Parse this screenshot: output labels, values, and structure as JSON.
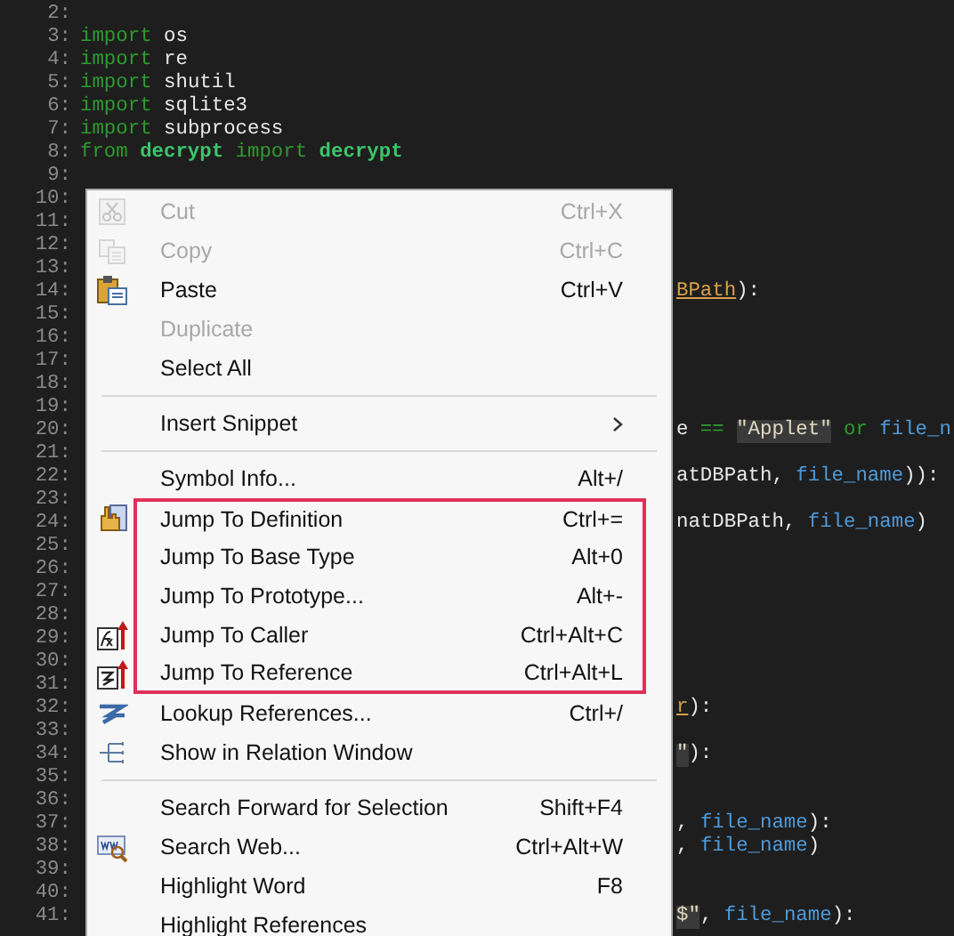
{
  "editor": {
    "lines": [
      {
        "number": "2:"
      },
      {
        "number": "3:",
        "clipped": false,
        "code": [
          {
            "text": "import",
            "kind": "keyword"
          },
          {
            "text": " os",
            "kind": "name"
          }
        ]
      },
      {
        "number": "4:",
        "clipped": false,
        "code": [
          {
            "text": "import",
            "kind": "keyword"
          },
          {
            "text": " re",
            "kind": "name"
          }
        ]
      },
      {
        "number": "5:",
        "clipped": false,
        "code": [
          {
            "text": "import",
            "kind": "keyword"
          },
          {
            "text": " shutil",
            "kind": "name"
          }
        ]
      },
      {
        "number": "6:",
        "clipped": false,
        "code": [
          {
            "text": "import",
            "kind": "keyword"
          },
          {
            "text": " sqlite3",
            "kind": "name"
          }
        ]
      },
      {
        "number": "7:",
        "clipped": false,
        "code": [
          {
            "text": "import",
            "kind": "keyword"
          },
          {
            "text": " subprocess",
            "kind": "name"
          }
        ]
      },
      {
        "number": "8:",
        "clipped": false,
        "code": [
          {
            "text": "from ",
            "kind": "keyword"
          },
          {
            "text": "decrypt",
            "kind": "module"
          },
          {
            "text": " import ",
            "kind": "keyword"
          },
          {
            "text": "decrypt",
            "kind": "module"
          }
        ]
      },
      {
        "number": "9:"
      },
      {
        "number": "10:"
      },
      {
        "number": "11:"
      },
      {
        "number": "12:"
      },
      {
        "number": "13:"
      },
      {
        "number": "14:",
        "clipped": true,
        "code": [
          {
            "text": "BPath",
            "kind": "reference"
          },
          {
            "text": "):",
            "kind": "name"
          }
        ]
      },
      {
        "number": "15:"
      },
      {
        "number": "16:"
      },
      {
        "number": "17:"
      },
      {
        "number": "18:"
      },
      {
        "number": "19:"
      },
      {
        "number": "20:",
        "clipped": true,
        "code": [
          {
            "text": "e",
            "kind": "name"
          },
          {
            "text": " == ",
            "kind": "operator"
          },
          {
            "text": "\"Applet\"",
            "kind": "string"
          },
          {
            "text": " or ",
            "kind": "keyword"
          },
          {
            "text": "file_n",
            "kind": "variable"
          }
        ]
      },
      {
        "number": "21:"
      },
      {
        "number": "22:",
        "clipped": true,
        "code": [
          {
            "text": "atDBPath, ",
            "kind": "name"
          },
          {
            "text": "file_name",
            "kind": "variable"
          },
          {
            "text": ")):",
            "kind": "name"
          }
        ]
      },
      {
        "number": "23:"
      },
      {
        "number": "24:",
        "clipped": true,
        "code": [
          {
            "text": "natDBPath, ",
            "kind": "name"
          },
          {
            "text": "file_name",
            "kind": "variable"
          },
          {
            "text": ")",
            "kind": "name"
          }
        ]
      },
      {
        "number": "25:"
      },
      {
        "number": "26:"
      },
      {
        "number": "27:"
      },
      {
        "number": "28:"
      },
      {
        "number": "29:"
      },
      {
        "number": "30:"
      },
      {
        "number": "31:"
      },
      {
        "number": "32:",
        "clipped": true,
        "code": [
          {
            "text": "r",
            "kind": "reference"
          },
          {
            "text": "):",
            "kind": "name"
          }
        ]
      },
      {
        "number": "33:"
      },
      {
        "number": "34:",
        "clipped": true,
        "code": [
          {
            "text": "\"",
            "kind": "string"
          },
          {
            "text": "):",
            "kind": "name"
          }
        ]
      },
      {
        "number": "35:"
      },
      {
        "number": "36:"
      },
      {
        "number": "37:",
        "clipped": true,
        "code": [
          {
            "text": ", ",
            "kind": "name"
          },
          {
            "text": "file_name",
            "kind": "variable"
          },
          {
            "text": "):",
            "kind": "name"
          }
        ]
      },
      {
        "number": "38:",
        "clipped": true,
        "code": [
          {
            "text": ", ",
            "kind": "name"
          },
          {
            "text": "file_name",
            "kind": "variable"
          },
          {
            "text": ")",
            "kind": "name"
          }
        ]
      },
      {
        "number": "39:"
      },
      {
        "number": "40:"
      },
      {
        "number": "41:",
        "clipped": true,
        "code": [
          {
            "text": "$\"",
            "kind": "string"
          },
          {
            "text": ", ",
            "kind": "name"
          },
          {
            "text": "file_name",
            "kind": "variable"
          },
          {
            "text": "):",
            "kind": "name"
          }
        ]
      }
    ]
  },
  "context_menu": {
    "groups": [
      {
        "items": [
          {
            "label": "Cut",
            "shortcut": "Ctrl+X",
            "disabled": true,
            "highlighted": false,
            "submenu": false
          },
          {
            "label": "Copy",
            "shortcut": "Ctrl+C",
            "disabled": true,
            "highlighted": false,
            "submenu": false
          },
          {
            "label": "Paste",
            "shortcut": "Ctrl+V",
            "disabled": false,
            "highlighted": false,
            "submenu": false
          },
          {
            "label": "Duplicate",
            "disabled": true,
            "highlighted": false,
            "submenu": false
          },
          {
            "label": "Select All",
            "disabled": false,
            "highlighted": false,
            "submenu": false
          }
        ]
      },
      {
        "items": [
          {
            "label": "Insert Snippet",
            "disabled": false,
            "highlighted": false,
            "submenu": true
          }
        ]
      },
      {
        "items": [
          {
            "label": "Symbol Info...",
            "shortcut": "Alt+/",
            "disabled": false,
            "highlighted": false,
            "submenu": false
          },
          {
            "label": "Jump To Definition",
            "shortcut": "Ctrl+=",
            "disabled": false,
            "highlighted": true,
            "submenu": false
          },
          {
            "label": "Jump To Base Type",
            "shortcut": "Alt+0",
            "disabled": false,
            "highlighted": true,
            "submenu": false
          },
          {
            "label": "Jump To Prototype...",
            "shortcut": "Alt+-",
            "disabled": false,
            "highlighted": true,
            "submenu": false
          },
          {
            "label": "Jump To Caller",
            "shortcut": "Ctrl+Alt+C",
            "disabled": false,
            "highlighted": true,
            "submenu": false
          },
          {
            "label": "Jump To Reference",
            "shortcut": "Ctrl+Alt+L",
            "disabled": false,
            "highlighted": true,
            "submenu": false
          },
          {
            "label": "Lookup References...",
            "shortcut": "Ctrl+/",
            "disabled": false,
            "highlighted": false,
            "submenu": false
          },
          {
            "label": "Show in Relation Window",
            "disabled": false,
            "highlighted": false,
            "submenu": false
          }
        ]
      },
      {
        "items": [
          {
            "label": "Search Forward for Selection",
            "shortcut": "Shift+F4",
            "disabled": false,
            "highlighted": false,
            "submenu": false
          },
          {
            "label": "Search Web...",
            "shortcut": "Ctrl+Alt+W",
            "disabled": false,
            "highlighted": false,
            "submenu": false
          },
          {
            "label": "Highlight Word",
            "shortcut": "F8",
            "disabled": false,
            "highlighted": false,
            "submenu": false
          },
          {
            "label": "Highlight References",
            "disabled": false,
            "highlighted": false,
            "submenu": false
          }
        ]
      }
    ]
  }
}
